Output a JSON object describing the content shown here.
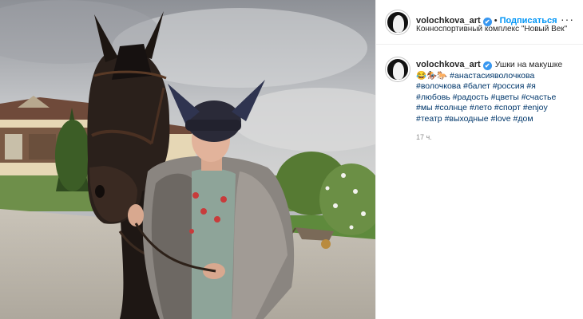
{
  "post": {
    "username": "volochkova_art",
    "verified_mark": "✔",
    "follow_separator": "•",
    "follow_label": "Подписаться",
    "location": "Конноспортивный комплекс \"Новый Век\"",
    "more_icon": "more-horizontal-icon",
    "more_label": "···"
  },
  "caption": {
    "username": "volochkova_art",
    "text": "Ушки на макушке",
    "emoji_line": "😂🏇🐎",
    "hashtags": [
      "#анастасияволочкова",
      "#волочкова",
      "#балет",
      "#россия",
      "#я",
      "#любовь",
      "#радость",
      "#цветы",
      "#счастье",
      "#мы",
      "#солнце",
      "#лето",
      "#спорт",
      "#enjoy",
      "#театр",
      "#выходные",
      "#love",
      "#дом"
    ]
  },
  "timestamp": "17 ч.",
  "colors": {
    "accent": "#0095f6",
    "hashtag": "#00376b",
    "verified": "#3897f0",
    "muted": "#8e8e8e"
  }
}
